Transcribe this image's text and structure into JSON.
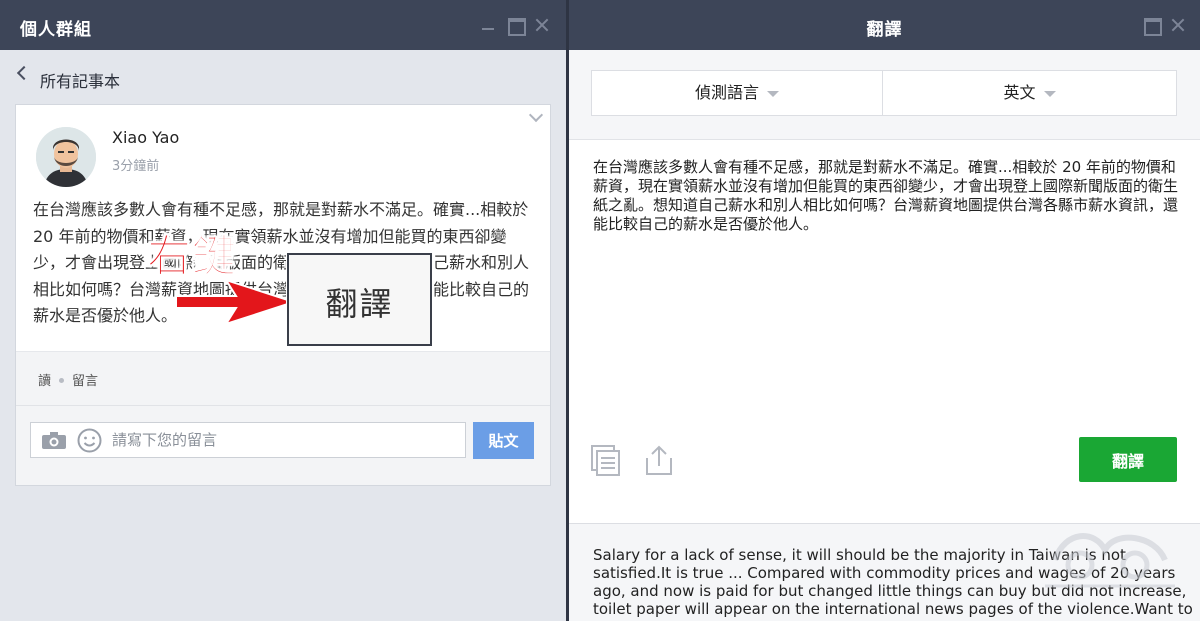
{
  "left_window": {
    "title": "個人群組",
    "back_label": "所有記事本",
    "post": {
      "author": "Xiao Yao",
      "time": "3分鐘前",
      "body": "在台灣應該多數人會有種不足感，那就是對薪水不滿足。確實...相較於 20 年前的物價和薪資，現在實領薪水並沒有增加但能買的東西卻變少，才會出現登上國際新聞版面的衛生紙之亂。想知道自己薪水和別人相比如何嗎？台灣薪資地圖提供台灣各縣市薪水資訊，還能比較自己的薪水是否優於他人。",
      "action_read": "讀",
      "action_comment": "留言"
    },
    "comment": {
      "placeholder": "請寫下您的留言",
      "submit_label": "貼文"
    }
  },
  "annotation": {
    "label": "右鍵",
    "context_menu_item": "翻譯",
    "color": "#e3161b"
  },
  "right_window": {
    "title": "翻譯",
    "source_language": "偵測語言",
    "target_language": "英文",
    "source_text": "在台灣應該多數人會有種不足感，那就是對薪水不滿足。確實...相較於 20 年前的物價和薪資，現在實領薪水並沒有增加但能買的東西卻變少，才會出現登上國際新聞版面的衛生紙之亂。想知道自己薪水和別人相比如何嗎？台灣薪資地圖提供台灣各縣市薪水資訊，還能比較自己的薪水是否優於他人。",
    "translate_button": "翻譯",
    "result_text": "Salary for a lack of sense, it will should be the majority in Taiwan is not satisfied.It is true ... Compared with commodity prices and wages of 20 years ago, and now is paid for but changed little things can buy but did not increase, toilet paper will appear on the international news pages of the violence.Want to"
  },
  "icons": {
    "back": "chevron-left-icon",
    "minimize": "minimize-icon",
    "maximize": "maximize-icon",
    "close": "close-icon",
    "camera": "camera-icon",
    "emoji": "smile-icon",
    "copy": "copy-icon",
    "share": "share-icon",
    "expand": "chevron-down-icon"
  },
  "colors": {
    "titlebar": "#3d4558",
    "post_button": "#6b9ee6",
    "translate_button": "#1aa734",
    "annotation_red": "#e3161b"
  }
}
